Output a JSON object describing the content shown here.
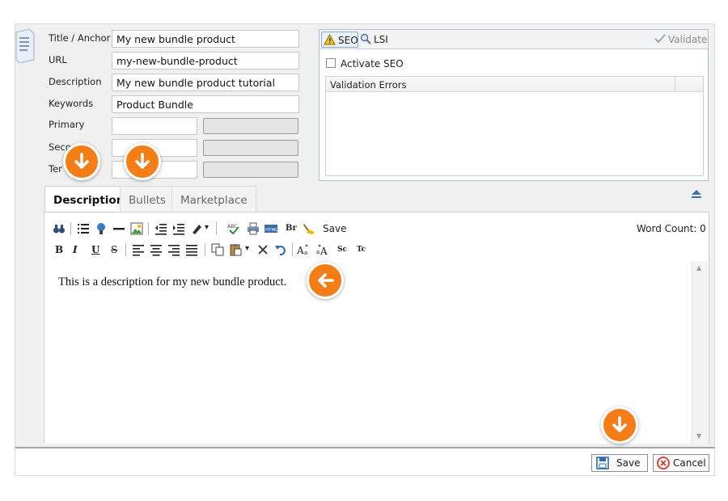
{
  "form": {
    "fields": [
      {
        "label": "Title / Anchor",
        "value": "My new bundle product"
      },
      {
        "label": "URL",
        "value": "my-new-bundle-product"
      },
      {
        "label": "Description",
        "value": "My new bundle product tutorial"
      },
      {
        "label": "Keywords",
        "value": "Product Bundle"
      }
    ],
    "keyword_rows": [
      {
        "label": "Primary",
        "value": ""
      },
      {
        "label": "Seco",
        "value": ""
      },
      {
        "label": "Ter",
        "value": ""
      }
    ]
  },
  "seo": {
    "tab_seo": "SEO",
    "tab_lsi": "LSI",
    "validate_label": "Validate",
    "activate_label": "Activate SEO",
    "activate_checked": false,
    "validation_header": "Validation Errors"
  },
  "tabs": [
    {
      "label": "Description",
      "active": true
    },
    {
      "label": "Bullets",
      "active": false
    },
    {
      "label": "Marketplace",
      "active": false
    }
  ],
  "toolbar": {
    "save_label": "Save",
    "br_label": "Br",
    "word_count_label": "Word Count: 0",
    "bold": "B",
    "italic": "I",
    "underline": "U",
    "strike": "S",
    "sc_label": "Sc",
    "tc_label": "Tc"
  },
  "editor": {
    "content": "This is a description for my new bundle product."
  },
  "footer": {
    "save_label": "Save",
    "cancel_label": "Cancel"
  },
  "colors": {
    "callout": "#f47d15",
    "panel_border": "#aebfd1",
    "cancel_red": "#d9342b"
  },
  "callouts": [
    {
      "icon": "arrow-down-icon"
    },
    {
      "icon": "arrow-down-icon"
    },
    {
      "icon": "arrow-left-icon"
    },
    {
      "icon": "arrow-down-icon"
    }
  ]
}
